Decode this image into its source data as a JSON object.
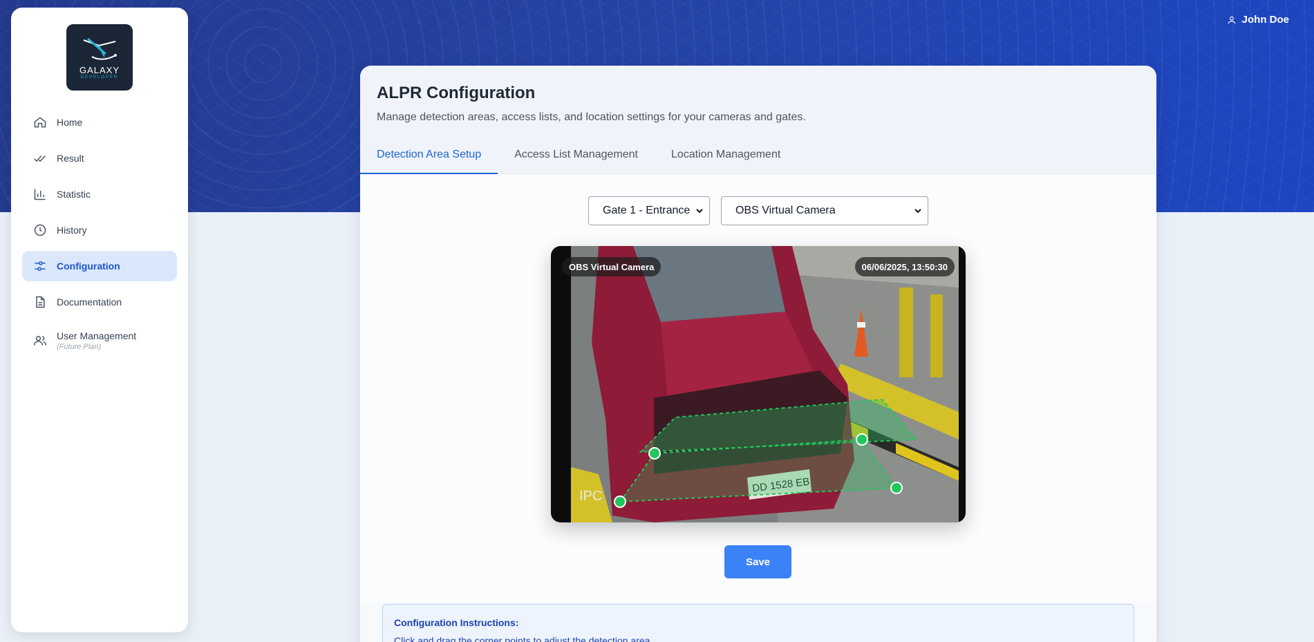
{
  "user": {
    "name": "John Doe"
  },
  "brand": {
    "name": "GALAXY",
    "sub": "DEVELOPER"
  },
  "sidebar": {
    "items": [
      {
        "label": "Home"
      },
      {
        "label": "Result"
      },
      {
        "label": "Statistic"
      },
      {
        "label": "History"
      },
      {
        "label": "Configuration",
        "active": true
      },
      {
        "label": "Documentation"
      },
      {
        "label": "User Management",
        "sub": "(Future Plan)"
      }
    ]
  },
  "page": {
    "title": "ALPR Configuration",
    "description": "Manage detection areas, access lists, and location settings for your cameras and gates."
  },
  "tabs": [
    {
      "label": "Detection Area Setup",
      "active": true
    },
    {
      "label": "Access List Management"
    },
    {
      "label": "Location Management"
    }
  ],
  "controls": {
    "gate_select": "Gate 1 - Entrance",
    "camera_select": "OBS Virtual Camera",
    "save_label": "Save"
  },
  "camera": {
    "name": "OBS Virtual Camera",
    "timestamp": "06/06/2025, 13:50:30",
    "plate_text": "DD 1528 EB",
    "overlay_color": "#22c55e"
  },
  "instructions": {
    "title": "Configuration Instructions:",
    "line1": "Click and drag the corner points to adjust the detection area"
  },
  "colors": {
    "accent": "#1d63d6",
    "banner": "#2344a6",
    "save": "#3b82f6"
  }
}
